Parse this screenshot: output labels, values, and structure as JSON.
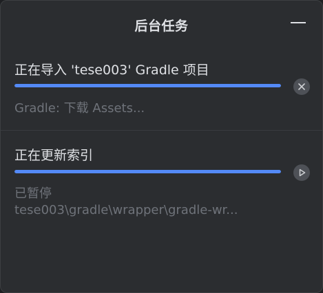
{
  "header": {
    "title": "后台任务"
  },
  "tasks": [
    {
      "title": "正在导入 'tese003' Gradle 项目",
      "progress": 1.0,
      "status": "Gradle: 下载 Assets...",
      "action_icon": "cancel-icon"
    },
    {
      "title": "正在更新索引",
      "progress": 1.0,
      "status": "已暂停",
      "detail": "tese003\\gradle\\wrapper\\gradle-wr...",
      "action_icon": "resume-icon"
    }
  ],
  "colors": {
    "background": "#2b2d30",
    "progress": "#548af7",
    "text": "#dfe1e5",
    "muted": "#6f737a"
  }
}
